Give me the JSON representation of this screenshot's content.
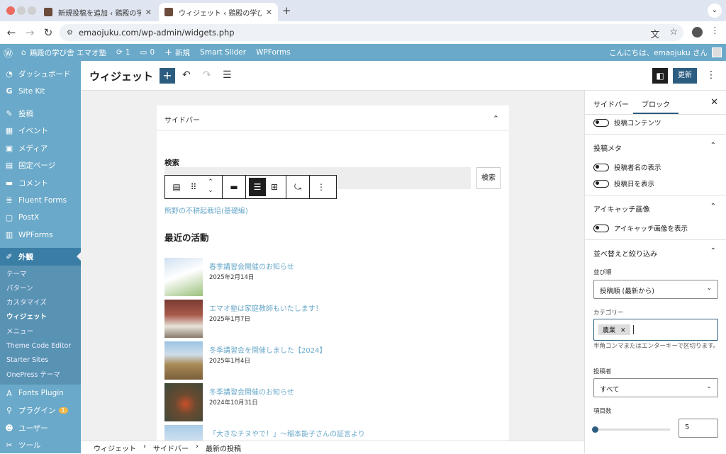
{
  "browser": {
    "tabs": [
      {
        "title": "新規投稿を追加 ‹ 鶏殿の学び舎 エ",
        "active": false
      },
      {
        "title": "ウィジェット ‹ 鶏殿の学び舎 エマ",
        "active": true
      }
    ],
    "new_tab": "+",
    "url": "emaojuku.com/wp-admin/widgets.php"
  },
  "adminbar": {
    "site_name": "鶏殿の学び舎 エマオ塾",
    "updates_count": "1",
    "comments_count": "0",
    "new_label": "新規",
    "smart_slider": "Smart Slider",
    "wpforms": "WPForms",
    "greeting": "こんにちは、emaojuku さん"
  },
  "sidebar": {
    "items": [
      {
        "label": "ダッシュボード",
        "icon": "dashboard-icon"
      },
      {
        "label": "Site Kit",
        "icon": "site-kit-icon"
      },
      {
        "label": "投稿",
        "icon": "pin-icon"
      },
      {
        "label": "イベント",
        "icon": "calendar-icon"
      },
      {
        "label": "メディア",
        "icon": "media-icon"
      },
      {
        "label": "固定ページ",
        "icon": "page-icon"
      },
      {
        "label": "コメント",
        "icon": "comment-icon"
      },
      {
        "label": "Fluent Forms",
        "icon": "forms-icon"
      },
      {
        "label": "PostX",
        "icon": "postx-icon"
      },
      {
        "label": "WPForms",
        "icon": "wpforms-icon"
      },
      {
        "label": "外観",
        "icon": "brush-icon"
      }
    ],
    "submenu": [
      "テーマ",
      "パターン",
      "カスタマイズ",
      "ウィジェット",
      "メニュー",
      "Theme Code Editor",
      "Starter Sites",
      "OnePress テーマ"
    ],
    "lower": [
      {
        "label": "Fonts Plugin",
        "icon": "fonts-icon"
      },
      {
        "label": "プラグイン",
        "icon": "plugin-icon",
        "badge": "1"
      },
      {
        "label": "ユーザー",
        "icon": "user-icon"
      },
      {
        "label": "ツール",
        "icon": "tools-icon"
      }
    ]
  },
  "editor": {
    "title": "ウィジェット",
    "update_label": "更新",
    "area_title": "サイドバー",
    "search_label": "検索",
    "search_button": "検索",
    "link_text": "熊野の不耕起栽培(基礎編)",
    "recent_title": "最近の活動",
    "posts": [
      {
        "title": "春季講習会開催のお知らせ",
        "date": "2025年2月14日"
      },
      {
        "title": "エマオ塾は家庭教師もいたします！",
        "date": "2025年1月7日"
      },
      {
        "title": "冬季講習会を開催しました【2024】",
        "date": "2025年1月4日"
      },
      {
        "title": "冬季講習会開催のお知らせ",
        "date": "2024年10月31日"
      },
      {
        "title": "「大きなチヌやで！」～稲本能子さんの証言より",
        "date": ""
      }
    ]
  },
  "breadcrumb": [
    "ウィジェット",
    "サイドバー",
    "最新の投稿"
  ],
  "panel": {
    "tab_sidebar": "サイドバー",
    "tab_block": "ブロック",
    "post_content": "投稿コンテンツ",
    "meta_title": "投稿メタ",
    "show_author": "投稿者名の表示",
    "show_date": "投稿日を表示",
    "featured_title": "アイキャッチ画像",
    "show_featured": "アイキャッチ画像を表示",
    "sort_title": "並べ替えと絞り込み",
    "order_label": "並び順",
    "order_value": "投稿順 (最新から)",
    "category_label": "カテゴリー",
    "category_tag": "農業",
    "category_help": "半角コンマまたはエンターキーで区切ります。",
    "author_label": "投稿者",
    "author_value": "すべて",
    "count_label": "項目数",
    "count_value": "5"
  },
  "colors": {
    "admin_blue": "#6aa9c9",
    "primary": "#2c5d80"
  }
}
